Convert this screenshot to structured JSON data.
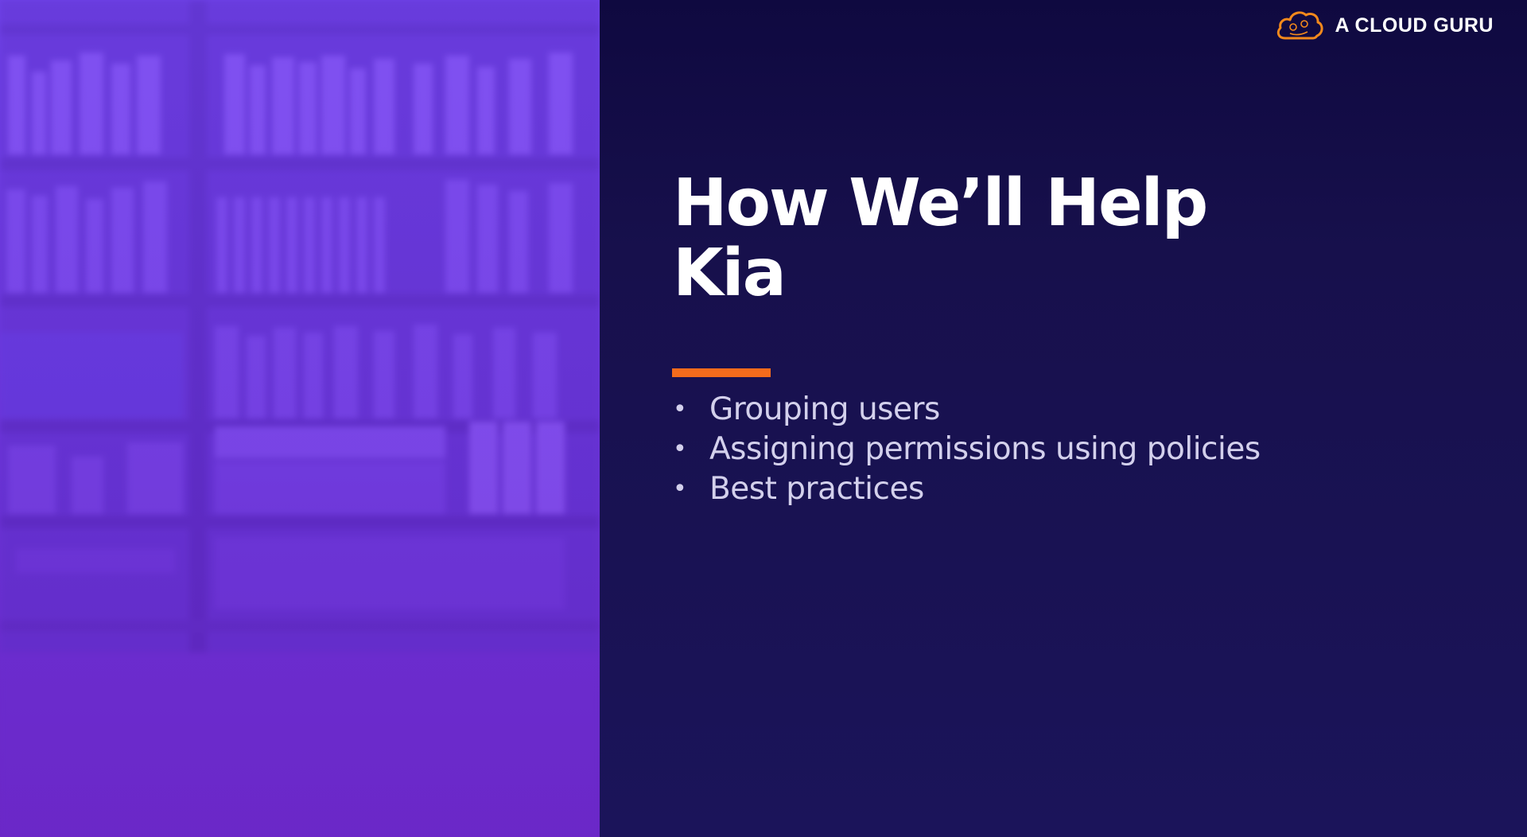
{
  "brand": {
    "name": "A CLOUD GURU",
    "logo_icon": "cloud-icon",
    "logo_color": "#f3891c"
  },
  "slide": {
    "title_line1": "How We’ll Help",
    "title_line2": "Kia",
    "accent_color": "#f36b1c",
    "bullets": [
      "Grouping users",
      "Assigning permissions using policies",
      "Best practices"
    ]
  },
  "colors": {
    "panel_background": "#17104c",
    "photo_tint": "#6a33d6",
    "title_text": "#ffffff",
    "bullet_text": "#d3d0ec"
  }
}
